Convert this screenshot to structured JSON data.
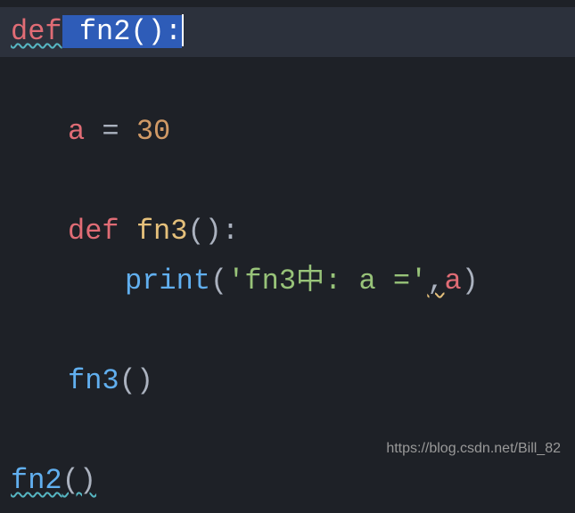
{
  "code": {
    "line1": {
      "def_kw": "def",
      "sp": " ",
      "func_name": "fn2",
      "parens": "()",
      "colon": ":"
    },
    "line3": {
      "var": "a",
      "sp1": " ",
      "op": "=",
      "sp2": " ",
      "num": "30"
    },
    "line5": {
      "def_kw": "def",
      "sp": " ",
      "func_name": "fn3",
      "parens": "()",
      "colon": ":"
    },
    "line6": {
      "print_name": "print",
      "paren_open": "(",
      "string": "'fn3中: a ='",
      "comma": ",",
      "var": "a",
      "paren_close": ")"
    },
    "line8": {
      "call_name": "fn3",
      "parens": "()"
    },
    "line10": {
      "call_name": "fn2",
      "parens": "()"
    }
  },
  "watermark": "https://blog.csdn.net/Bill_82"
}
